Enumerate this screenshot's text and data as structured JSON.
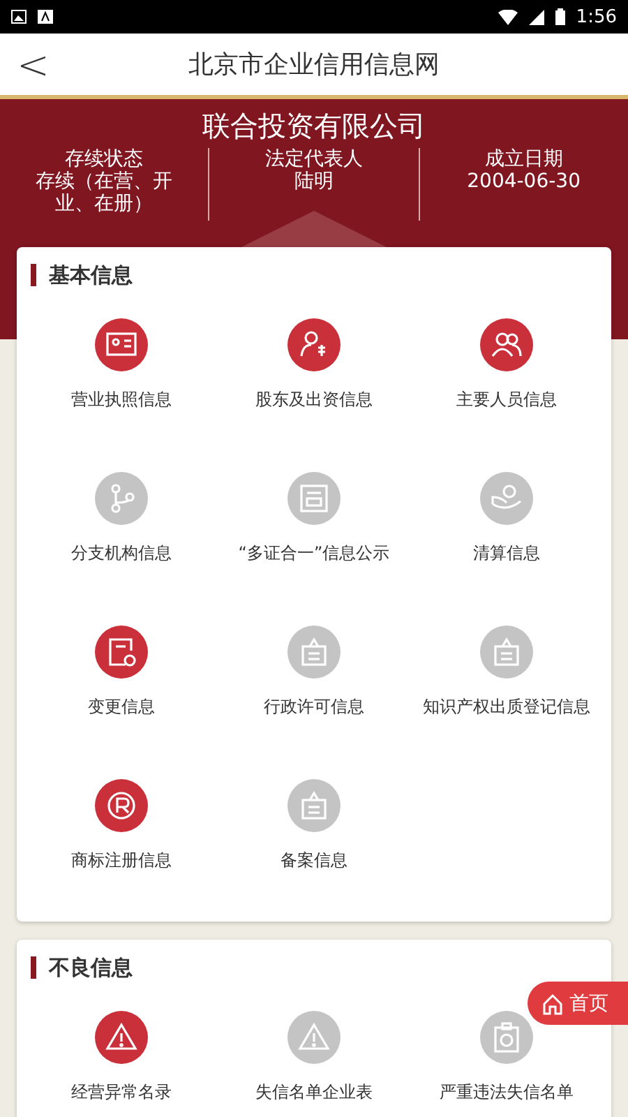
{
  "status_bar": {
    "time": "1:56"
  },
  "header": {
    "back": "<",
    "title": "北京市企业信用信息网"
  },
  "company": {
    "name": "联合投资有限公司",
    "facts": [
      {
        "label": "存续状态",
        "value": "存续（在营、开业、在册）"
      },
      {
        "label": "法定代表人",
        "value": "陆明"
      },
      {
        "label": "成立日期",
        "value": "2004-06-30"
      }
    ]
  },
  "sections": [
    {
      "title": "基本信息",
      "items": [
        {
          "label": "营业执照信息",
          "kind": "license",
          "enabled": true
        },
        {
          "label": "股东及出资信息",
          "kind": "shareholder",
          "enabled": true
        },
        {
          "label": "主要人员信息",
          "kind": "people",
          "enabled": true
        },
        {
          "label": "分支机构信息",
          "kind": "branch",
          "enabled": false
        },
        {
          "label": "“多证合一”信息公示",
          "kind": "certificate",
          "enabled": false
        },
        {
          "label": "清算信息",
          "kind": "liquidation",
          "enabled": false
        },
        {
          "label": "变更信息",
          "kind": "change",
          "enabled": true
        },
        {
          "label": "行政许可信息",
          "kind": "notice",
          "enabled": false
        },
        {
          "label": "知识产权出质登记信息",
          "kind": "notice",
          "enabled": false
        },
        {
          "label": "商标注册信息",
          "kind": "trademark",
          "enabled": true
        },
        {
          "label": "备案信息",
          "kind": "notice",
          "enabled": false
        }
      ]
    },
    {
      "title": "不良信息",
      "items": [
        {
          "label": "经营异常名录",
          "kind": "warning",
          "enabled": true
        },
        {
          "label": "失信名单企业表",
          "kind": "warning",
          "enabled": false
        },
        {
          "label": "严重违法失信名单",
          "kind": "clipboard",
          "enabled": false
        }
      ]
    }
  ],
  "home_button": {
    "label": "首页"
  }
}
